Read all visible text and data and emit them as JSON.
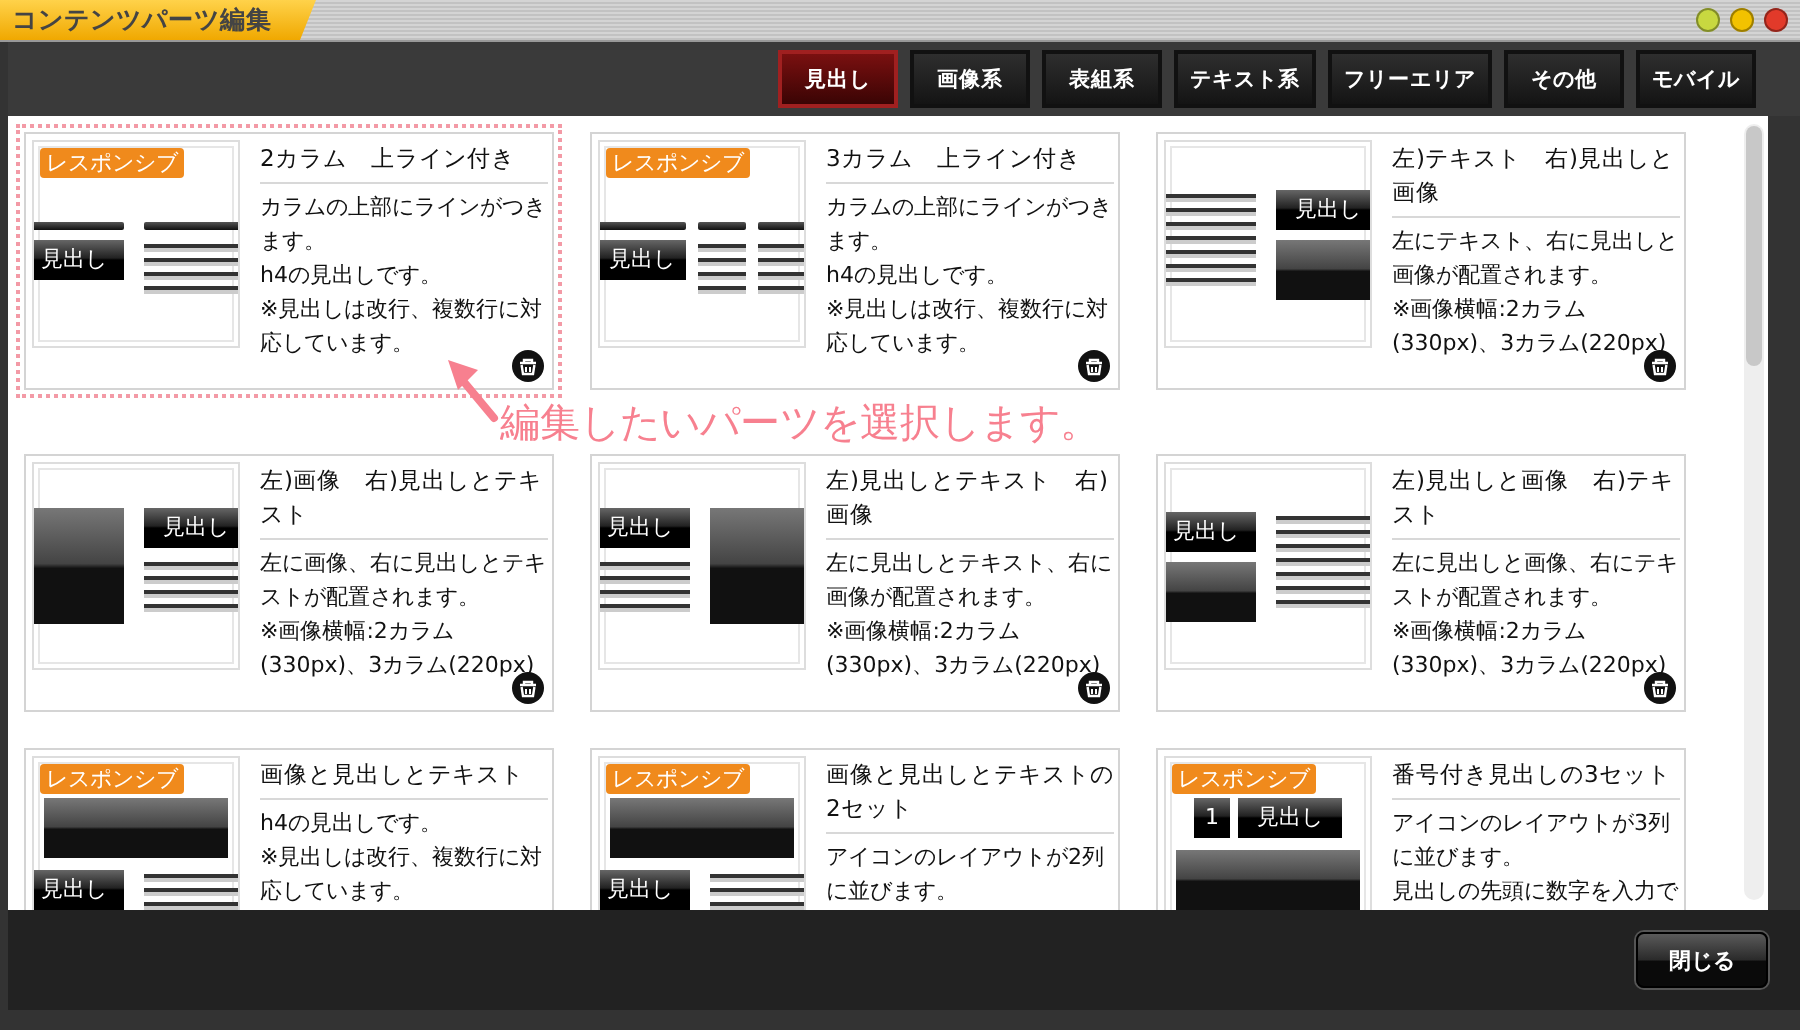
{
  "window": {
    "title": "コンテンツパーツ編集"
  },
  "window_buttons": [
    {
      "color": "#c8d840"
    },
    {
      "color": "#f2c200"
    },
    {
      "color": "#e23a2a"
    }
  ],
  "tabs": [
    {
      "label": "見出し",
      "selected": true
    },
    {
      "label": "画像系",
      "selected": false
    },
    {
      "label": "表組系",
      "selected": false
    },
    {
      "label": "テキスト系",
      "selected": false
    },
    {
      "label": "フリーエリア",
      "selected": false
    },
    {
      "label": "その他",
      "selected": false
    },
    {
      "label": "モバイル",
      "selected": false
    }
  ],
  "cards": [
    {
      "title": "2カラム　上ライン付き",
      "badge": "レスポンシブ",
      "selected": true,
      "trash": true,
      "description": [
        "カラムの上部にラインがつきます。",
        "h4の見出しです。",
        "※見出しは改行、複数行に対応しています。"
      ],
      "thumbnail": [
        {
          "kind": "two",
          "columns": [
            [
              {
                "kind": "bar"
              },
              {
                "kind": "heading",
                "text": "見出し"
              }
            ],
            [
              {
                "kind": "bar"
              },
              {
                "kind": "lines"
              }
            ]
          ]
        }
      ]
    },
    {
      "title": "3カラム　上ライン付き",
      "badge": "レスポンシブ",
      "selected": false,
      "trash": true,
      "description": [
        "カラムの上部にラインがつきます。",
        "h4の見出しです。",
        "※見出しは改行、複数行に対応しています。"
      ],
      "thumbnail": [
        {
          "kind": "three",
          "columns": [
            [
              {
                "kind": "bar"
              },
              {
                "kind": "heading",
                "text": "見出し"
              }
            ],
            [
              {
                "kind": "bar"
              },
              {
                "kind": "lines"
              }
            ],
            [
              {
                "kind": "bar"
              },
              {
                "kind": "lines"
              }
            ]
          ]
        }
      ]
    },
    {
      "title": "左)テキスト　右)見出しと画像",
      "selected": false,
      "trash": true,
      "description": [
        "左にテキスト、右に見出しと画像が配置されます。",
        "※画像横幅:2カラム(330px)、3カラム(220px)"
      ],
      "thumbnail": [
        {
          "kind": "two",
          "columns": [
            [
              {
                "kind": "long-lines"
              }
            ],
            [
              {
                "kind": "heading",
                "text": "見出し"
              },
              {
                "kind": "image"
              }
            ]
          ]
        }
      ]
    },
    {
      "title": "左)画像　右)見出しとテキスト",
      "selected": false,
      "trash": true,
      "description": [
        "左に画像、右に見出しとテキストが配置されます。",
        "※画像横幅:2カラム(330px)、3カラム(220px)"
      ],
      "thumbnail": [
        {
          "kind": "two",
          "columns": [
            [
              {
                "kind": "tall-image"
              }
            ],
            [
              {
                "kind": "heading",
                "text": "見出し"
              },
              {
                "kind": "lines"
              }
            ]
          ]
        }
      ]
    },
    {
      "title": "左)見出しとテキスト　右)画像",
      "selected": false,
      "trash": true,
      "description": [
        "左に見出しとテキスト、右に画像が配置されます。",
        "※画像横幅:2カラム(330px)、3カラム(220px)"
      ],
      "thumbnail": [
        {
          "kind": "two",
          "columns": [
            [
              {
                "kind": "heading",
                "text": "見出し"
              },
              {
                "kind": "lines"
              }
            ],
            [
              {
                "kind": "tall-image"
              }
            ]
          ]
        }
      ]
    },
    {
      "title": "左)見出しと画像　右)テキスト",
      "selected": false,
      "trash": true,
      "description": [
        "左に見出しと画像、右にテキストが配置されます。",
        "※画像横幅:2カラム(330px)、3カラム(220px)"
      ],
      "thumbnail": [
        {
          "kind": "two",
          "columns": [
            [
              {
                "kind": "heading",
                "text": "見出し"
              },
              {
                "kind": "image"
              }
            ],
            [
              {
                "kind": "long-lines"
              }
            ]
          ]
        }
      ]
    },
    {
      "title": "画像と見出しとテキスト",
      "badge": "レスポンシブ",
      "selected": false,
      "trash": false,
      "description": [
        "h4の見出しです。",
        "※見出しは改行、複数行に対応しています。"
      ],
      "thumbnail": [
        {
          "kind": "one",
          "columns": [
            [
              {
                "kind": "image"
              }
            ]
          ]
        },
        {
          "kind": "two",
          "columns": [
            [
              {
                "kind": "heading",
                "text": "見出し"
              }
            ],
            [
              {
                "kind": "lines"
              }
            ]
          ]
        }
      ]
    },
    {
      "title": "画像と見出しとテキストの2セット",
      "badge": "レスポンシブ",
      "selected": false,
      "trash": false,
      "description": [
        "アイコンのレイアウトが2列に並びます。"
      ],
      "thumbnail": [
        {
          "kind": "one",
          "columns": [
            [
              {
                "kind": "image"
              }
            ]
          ]
        },
        {
          "kind": "two",
          "columns": [
            [
              {
                "kind": "heading",
                "text": "見出し"
              }
            ],
            [
              {
                "kind": "lines"
              }
            ]
          ]
        }
      ]
    },
    {
      "title": "番号付き見出しの3セット",
      "badge": "レスポンシブ",
      "selected": false,
      "trash": false,
      "description": [
        "アイコンのレイアウトが3列に並びます。",
        "見出しの先頭に数字を入力で"
      ],
      "thumbnail": [
        {
          "kind": "numbered",
          "columns": [
            [
              {
                "kind": "number",
                "text": "1"
              }
            ],
            [
              {
                "kind": "heading",
                "text": "見出し"
              }
            ]
          ]
        },
        {
          "kind": "one",
          "columns": [
            [
              {
                "kind": "image"
              }
            ]
          ]
        }
      ]
    }
  ],
  "annotation": "編集したいパーツを選択します。",
  "close_button": "閉じる"
}
